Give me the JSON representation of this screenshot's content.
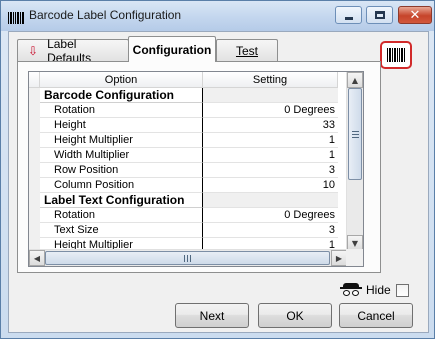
{
  "window": {
    "title": "Barcode Label Configuration",
    "buttons": {
      "minimize_icon": "minimize-icon",
      "maximize_icon": "maximize-icon",
      "close_icon": "close-icon",
      "close_glyph": "✕"
    }
  },
  "tabs": [
    {
      "label": "Label Defaults",
      "icon": "red-down-arrow-icon",
      "glyph": "⇩"
    },
    {
      "label": "Configuration",
      "active": true
    },
    {
      "label": "Test"
    }
  ],
  "grid": {
    "headers": {
      "option": "Option",
      "setting": "Setting"
    },
    "rows": [
      {
        "option": "Barcode Configuration",
        "setting": "",
        "section": true
      },
      {
        "option": "Rotation",
        "setting": "0 Degrees"
      },
      {
        "option": "Height",
        "setting": "33"
      },
      {
        "option": "Height Multiplier",
        "setting": "1"
      },
      {
        "option": "Width Multiplier",
        "setting": "1"
      },
      {
        "option": "Row Position",
        "setting": "3"
      },
      {
        "option": "Column Position",
        "setting": "10"
      },
      {
        "option": "Label Text Configuration",
        "setting": "",
        "section": true
      },
      {
        "option": "Rotation",
        "setting": "0 Degrees"
      },
      {
        "option": "Text Size",
        "setting": "3"
      },
      {
        "option": "Height Multiplier",
        "setting": "1"
      }
    ],
    "scroll_glyphs": {
      "up": "▲",
      "down": "▼",
      "left": "◀",
      "right": "▶"
    }
  },
  "hide": {
    "label": "Hide",
    "checked": false,
    "icon": "spy-icon"
  },
  "footer": {
    "next_label": "Next",
    "ok_label": "OK",
    "cancel_label": "Cancel"
  },
  "colors": {
    "accent_red": "#d12a2a",
    "title_bar": "#c3d6ee"
  }
}
